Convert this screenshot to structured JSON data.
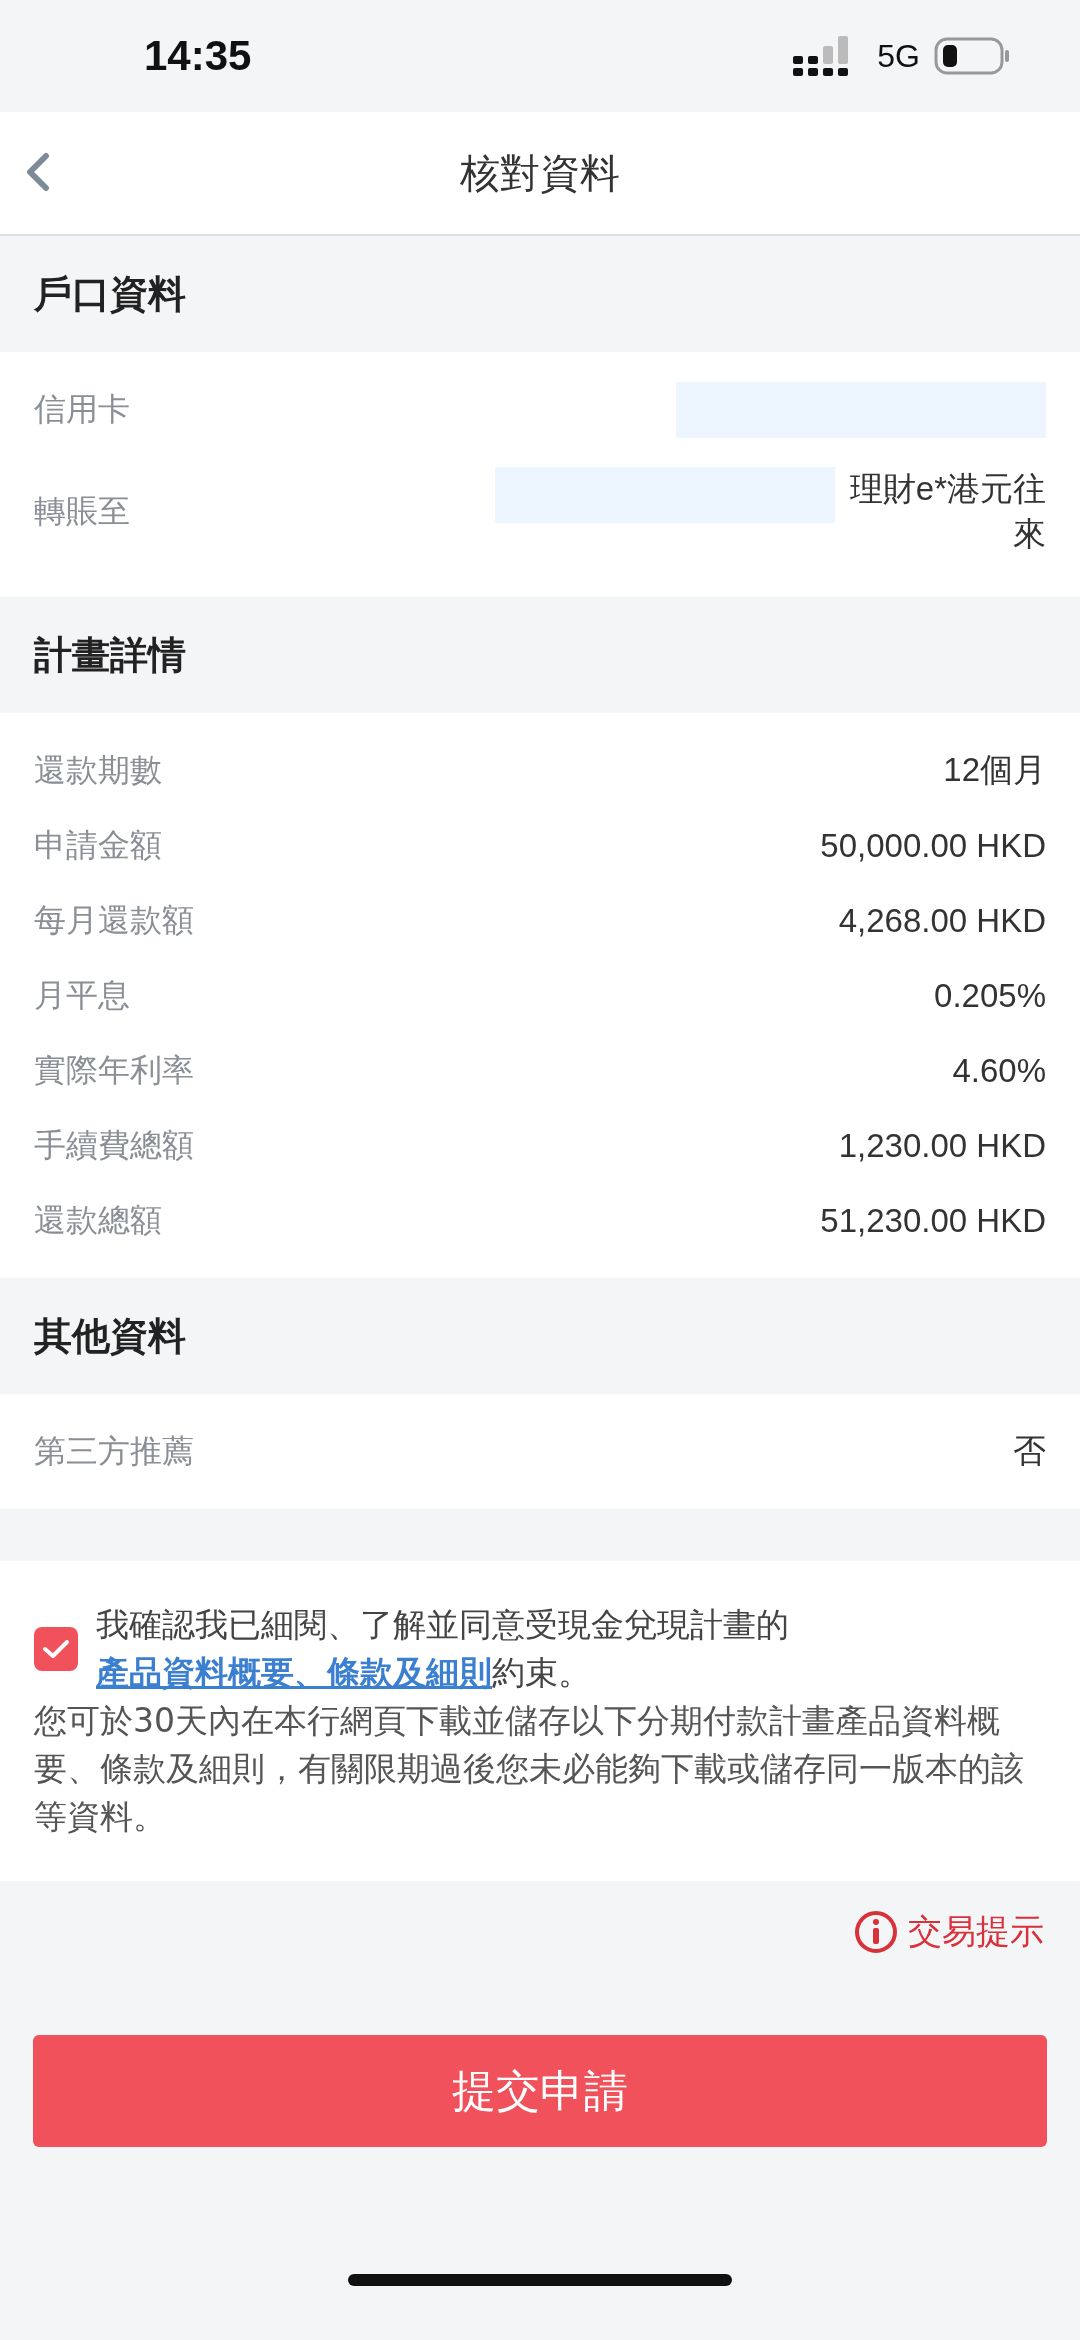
{
  "status_bar": {
    "time": "14:35",
    "network": "5G"
  },
  "header": {
    "title": "核對資料"
  },
  "sections": [
    {
      "title": "戶口資料",
      "rows": [
        {
          "label": "信用卡",
          "value": "",
          "redacted": true
        },
        {
          "label": "轉賬至",
          "value": "理財e*港元往來",
          "redacted": true
        }
      ]
    },
    {
      "title": "計畫詳情",
      "rows": [
        {
          "label": "還款期數",
          "value": "12個月"
        },
        {
          "label": "申請金額",
          "value": "50,000.00 HKD"
        },
        {
          "label": "每月還款額",
          "value": "4,268.00 HKD"
        },
        {
          "label": "月平息",
          "value": "0.205%"
        },
        {
          "label": "實際年利率",
          "value": "4.60%"
        },
        {
          "label": "手續費總額",
          "value": "1,230.00 HKD"
        },
        {
          "label": "還款總額",
          "value": "51,230.00 HKD"
        }
      ]
    },
    {
      "title": "其他資料",
      "rows": [
        {
          "label": "第三方推薦",
          "value": "否"
        }
      ]
    }
  ],
  "consent": {
    "checked": true,
    "text_before": "我確認我已細閱、了解並同意受現金兌現計畫的",
    "link": "產品資料概要、條款及細則",
    "text_after": "約束。",
    "note": "您可於30天內在本行網頁下載並儲存以下分期付款計畫產品資料概要、條款及細則，有關限期過後您未必能夠下載或儲存同一版本的該等資料。"
  },
  "tip": {
    "label": "交易提示"
  },
  "submit": {
    "label": "提交申請"
  }
}
